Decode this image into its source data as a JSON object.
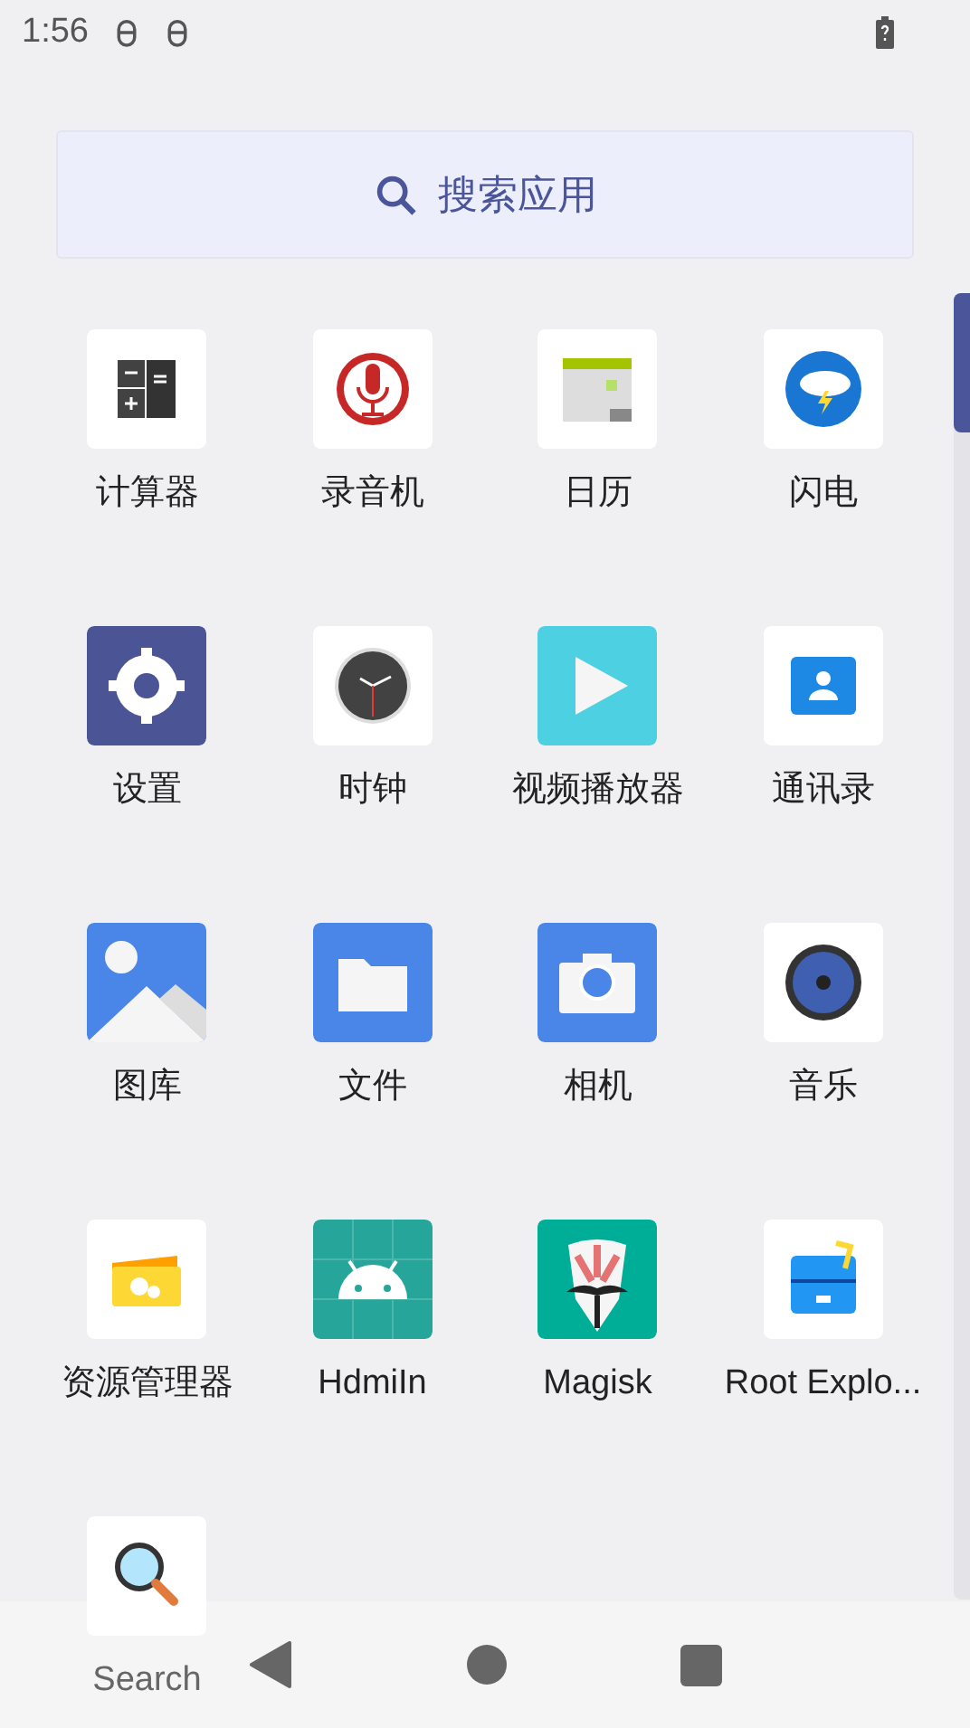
{
  "status_bar": {
    "time": "1:56"
  },
  "search": {
    "placeholder": "搜索应用"
  },
  "apps": [
    {
      "label": "计算器"
    },
    {
      "label": "录音机"
    },
    {
      "label": "日历"
    },
    {
      "label": "闪电"
    },
    {
      "label": "设置"
    },
    {
      "label": "时钟"
    },
    {
      "label": "视频播放器"
    },
    {
      "label": "通讯录"
    },
    {
      "label": "图库"
    },
    {
      "label": "文件"
    },
    {
      "label": "相机"
    },
    {
      "label": "音乐"
    },
    {
      "label": "资源管理器"
    },
    {
      "label": "HdmiIn"
    },
    {
      "label": "Magisk"
    },
    {
      "label": "Root Explo..."
    },
    {
      "label": "Search"
    }
  ]
}
